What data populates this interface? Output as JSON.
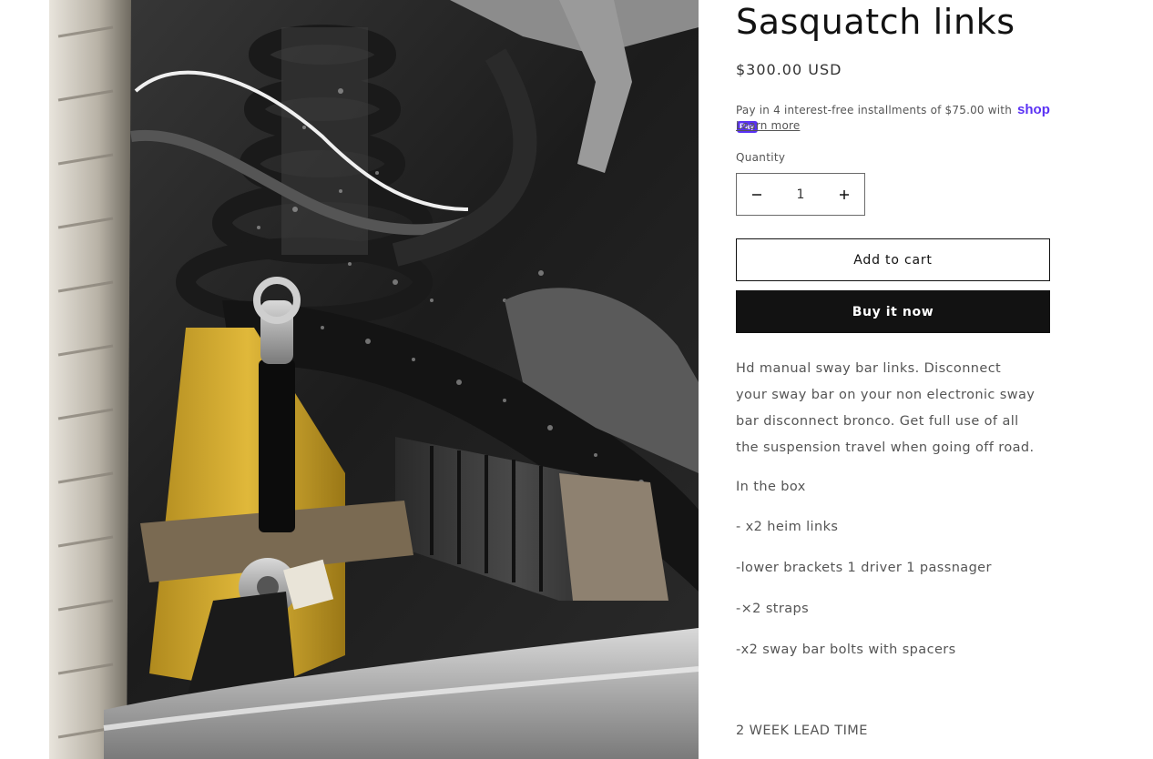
{
  "product": {
    "title": "Sasquatch links",
    "price": "$300.00 USD",
    "installments_text": "Pay in 4 interest-free installments of $75.00 with",
    "shop_pay_brand": "shop",
    "shop_pay_badge": "Pay",
    "learn_more": "Learn more",
    "quantity_label": "Quantity",
    "quantity_value": "1",
    "add_to_cart": "Add to cart",
    "buy_it_now": "Buy it now",
    "description": "Hd manual sway bar links. Disconnect your sway bar on your non electronic sway bar disconnect bronco. Get full use of all the suspension travel when going off road.",
    "in_the_box_label": "In the box",
    "box_items": [
      "- x2 heim links",
      "-lower brackets 1 driver 1 passnager",
      "-×2 straps",
      "-x2 sway bar bolts with spacers"
    ],
    "lead_time": "2 WEEK LEAD TIME"
  },
  "colors": {
    "text": "#121212",
    "muted": "#555555",
    "shop_pay": "#5a31f4",
    "button_dark": "#121212"
  },
  "icons": {
    "minus": "minus-icon",
    "plus": "plus-icon"
  }
}
